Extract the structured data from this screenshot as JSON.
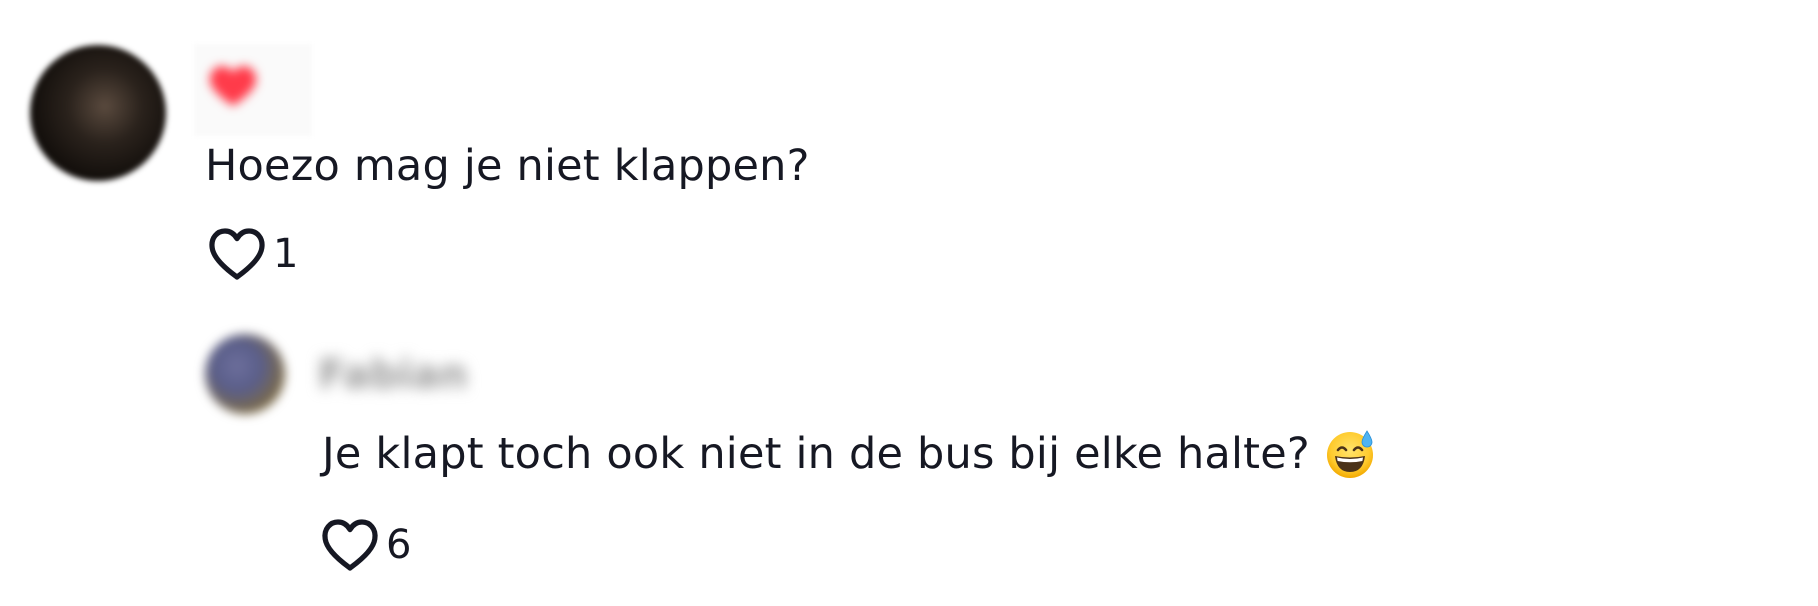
{
  "comment": {
    "username": "",
    "text": "Hoezo mag je niet klappen?",
    "likes": "1",
    "badge_icon": "heart-icon",
    "badge_color": "#ff3b4a"
  },
  "reply": {
    "username": "Fabian",
    "text": "Je klapt toch ook niet in de bus bij elke halte?",
    "emoji": "grinning-face-with-sweat",
    "likes": "6"
  },
  "colors": {
    "text": "#161823",
    "background": "#ffffff"
  }
}
